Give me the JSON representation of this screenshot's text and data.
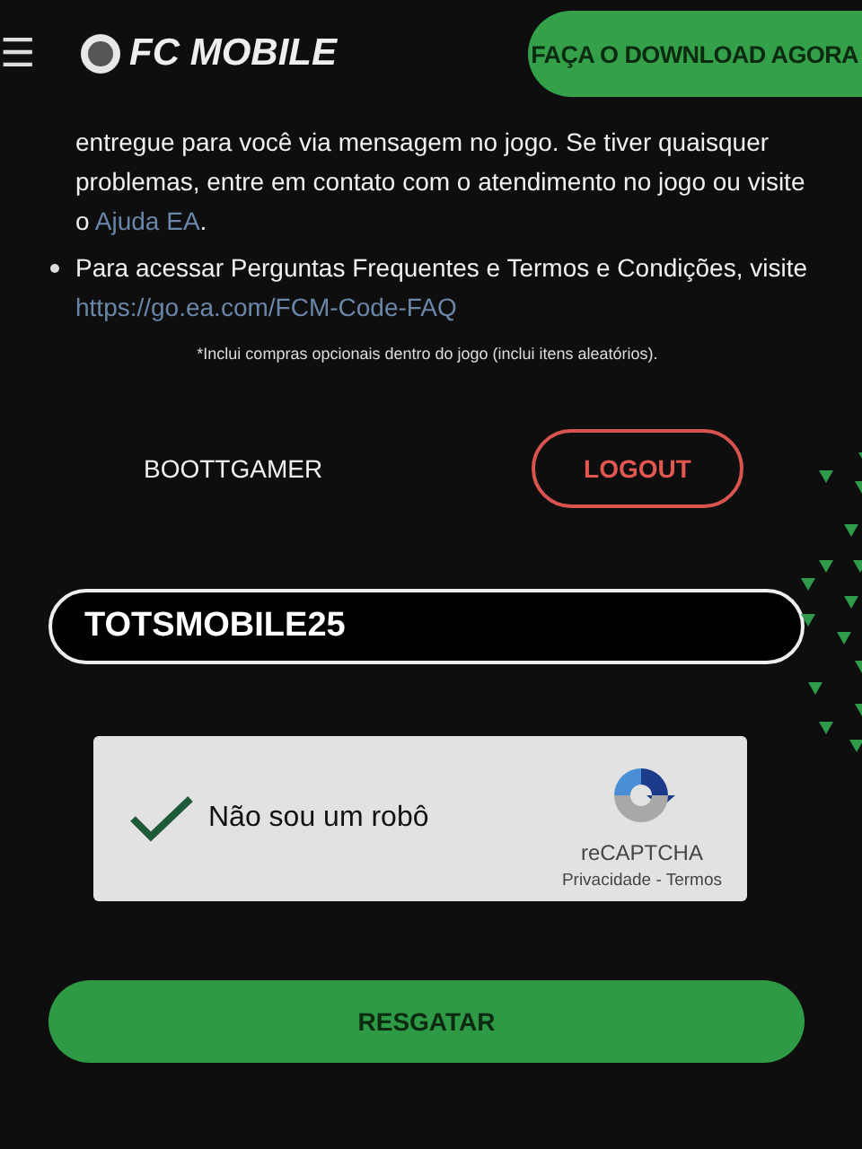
{
  "header": {
    "menu_icon": "☰",
    "logo": "FC MOBILE",
    "download_button": "FAÇA O DOWNLOAD AGORA"
  },
  "intro": {
    "text": "entregue para você via mensagem no jogo. Se tiver quaisquer problemas, entre em contato com o atendimento no jogo ou visite o ",
    "link": "Ajuda EA",
    "end": "."
  },
  "bullets": [
    {
      "text": "Para acessar Perguntas Frequentes e Termos e Condições, visite",
      "link": "https://go.ea.com/FCM-Code-FAQ"
    }
  ],
  "footnote": "*Inclui compras opcionais dentro do jogo (inclui itens aleatórios).",
  "user": {
    "name": "BOOTTGAMER",
    "logout_button": "LOGOUT"
  },
  "code_field": {
    "value": "TOTSMOBILE25"
  },
  "captcha": {
    "checked": true,
    "label": "Não sou um robô",
    "brand": "reCAPTCHA",
    "links": "Privacidade - Termos"
  },
  "submit_button": "RESGATAR"
}
